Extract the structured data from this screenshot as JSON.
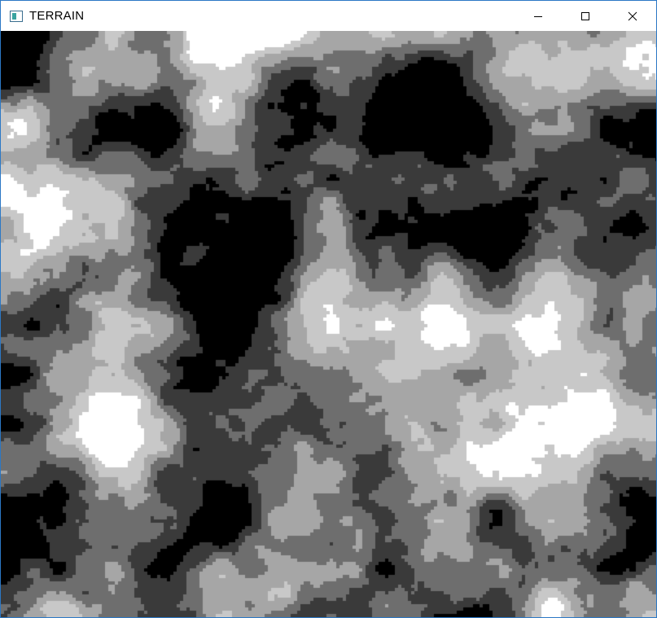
{
  "window": {
    "title": "TERRAIN",
    "app_icon": "window-app-icon",
    "controls": [
      {
        "name": "minimize-button",
        "icon": "minimize-icon"
      },
      {
        "name": "maximize-button",
        "icon": "maximize-icon"
      },
      {
        "name": "close-button",
        "icon": "close-icon"
      }
    ]
  },
  "terrain": {
    "levels": [
      "#000000",
      "#3a3a3a",
      "#6e6e6e",
      "#a6a6a6",
      "#c8c8c8",
      "#ffffff"
    ]
  }
}
